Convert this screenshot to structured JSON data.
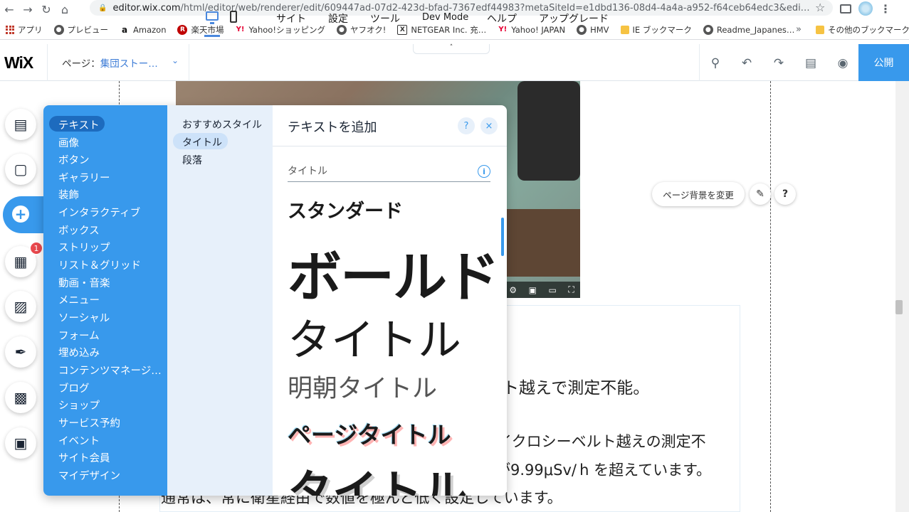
{
  "browser": {
    "url_host": "editor.wix.com",
    "url_rest": "/html/editor/web/renderer/edit/609447ad-07d2-423d-bfad-7367edf44983?metaSiteId=e1dbd136-08d4-4a4a-a952-f64ceb64edc3&edi…",
    "bookmarks": [
      {
        "label": "アプリ",
        "icon": "apps-grid-icon"
      },
      {
        "label": "プレビュー",
        "icon": "globe-icon"
      },
      {
        "label": "Amazon",
        "icon": "amazon-icon"
      },
      {
        "label": "楽天市場",
        "icon": "rakuten-icon"
      },
      {
        "label": "Yahoo!ショッピング",
        "icon": "yahoo-icon"
      },
      {
        "label": "ヤフオク!",
        "icon": "globe-icon"
      },
      {
        "label": "NETGEAR Inc. 充…",
        "icon": "netgear-icon"
      },
      {
        "label": "Yahoo! JAPAN",
        "icon": "yahoo-icon"
      },
      {
        "label": "HMV",
        "icon": "globe-icon"
      },
      {
        "label": "IE ブックマーク",
        "icon": "folder-icon"
      },
      {
        "label": "Readme_Japanes…",
        "icon": "globe-icon"
      }
    ],
    "more": "»",
    "other_bookmarks": "その他のブックマーク"
  },
  "wix": {
    "logo": "WiX",
    "page_label": "ページ：",
    "page_value": "集団ストー…",
    "menu": {
      "site": "サイト",
      "settings": "設定",
      "tools": "ツール",
      "dev_mode": "Dev Mode",
      "help": "ヘルプ",
      "upgrade": "アップグレード"
    },
    "collapse": "˄",
    "publish": "公開"
  },
  "canvas": {
    "change_bg": "ページ背景を変更",
    "help": "?",
    "line1": "ルト越えで測定不能。",
    "line2": "イクロシーベルト越えの測定不",
    "line3": "が9.99μSv/ h を超えています。",
    "line4": "通常は、常に衛星経由で数値を極んど低く設定しています。"
  },
  "rail": {
    "badge": "1"
  },
  "panel": {
    "categories": [
      "テキスト",
      "画像",
      "ボタン",
      "ギャラリー",
      "装飾",
      "インタラクティブ",
      "ボックス",
      "ストリップ",
      "リスト＆グリッド",
      "動画・音楽",
      "メニュー",
      "ソーシャル",
      "フォーム",
      "埋め込み",
      "コンテンツマネージ…",
      "ブログ",
      "ショップ",
      "サービス予約",
      "イベント",
      "サイト会員",
      "マイデザイン"
    ],
    "subcategories": [
      "おすすめスタイル",
      "タイトル",
      "段落"
    ],
    "header": "テキストを追加",
    "help": "?",
    "close": "×",
    "section": "タイトル",
    "info": "i",
    "samples": {
      "standard": "スタンダード",
      "bold": "ボールド",
      "title": "タイトル",
      "mincho": "明朝タイトル",
      "page_title": "ページタイトル",
      "big_title": "タイトル"
    }
  },
  "colors": {
    "accent": "#3899ec",
    "accent_dark": "#1d6bbe"
  }
}
